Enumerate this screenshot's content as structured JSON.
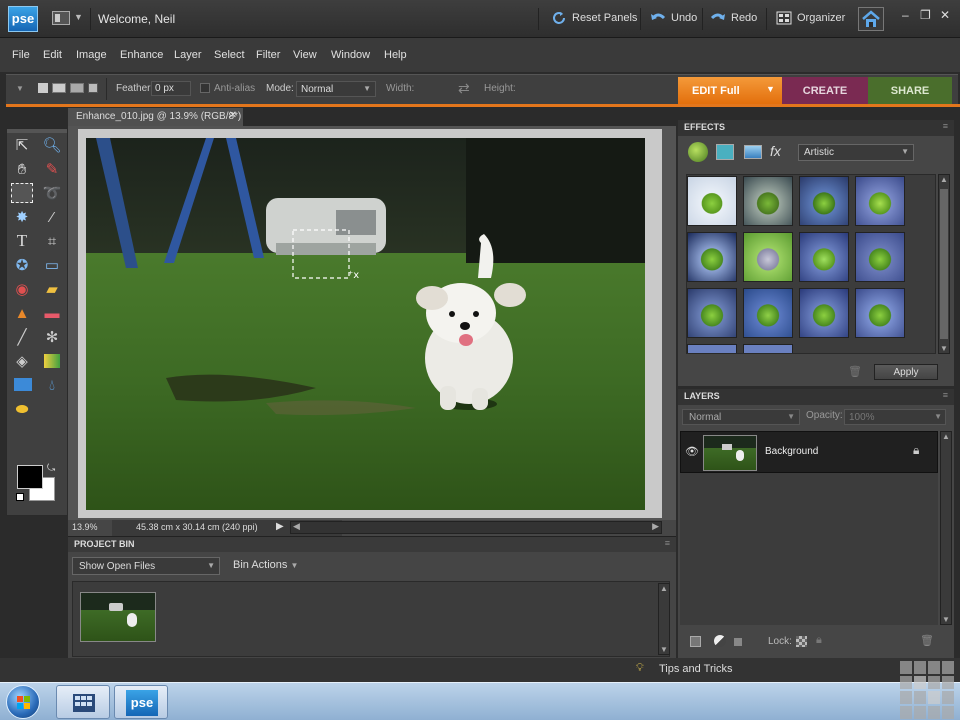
{
  "app": {
    "logo": "pse",
    "welcome": "Welcome, Neil",
    "reset_panels": "Reset Panels",
    "undo": "Undo",
    "redo": "Redo",
    "organizer": "Organizer"
  },
  "menu": [
    "File",
    "Edit",
    "Image",
    "Enhance",
    "Layer",
    "Select",
    "Filter",
    "View",
    "Window",
    "Help"
  ],
  "options": {
    "feather_label": "Feather:",
    "feather_value": "0 px",
    "antialias_label": "Anti-alias",
    "mode_label": "Mode:",
    "mode_value": "Normal",
    "width_label": "Width:",
    "height_label": "Height:"
  },
  "mode_tabs": {
    "edit": "EDIT Full",
    "create": "CREATE",
    "share": "SHARE"
  },
  "document": {
    "tab_title": "Enhance_010.jpg @ 13.9% (RGB/8*)",
    "zoom": "13.9%",
    "dimensions": "45.38 cm x 30.14 cm (240 ppi)"
  },
  "project_bin": {
    "title": "PROJECT BIN",
    "show_value": "Show Open Files",
    "bin_actions": "Bin Actions"
  },
  "effects": {
    "title": "EFFECTS",
    "category": "Artistic",
    "apply": "Apply"
  },
  "layers": {
    "title": "LAYERS",
    "blend_mode": "Normal",
    "opacity_label": "Opacity:",
    "opacity_value": "100%",
    "layer_name": "Background",
    "lock_label": "Lock:"
  },
  "tips": "Tips and Tricks",
  "taskbar": {
    "pse_label": "pse"
  },
  "colors": {
    "accent_orange": "#e3761c",
    "create_purple": "#7a2a52",
    "share_green": "#4a6e2c",
    "panel_bg": "#464646"
  }
}
